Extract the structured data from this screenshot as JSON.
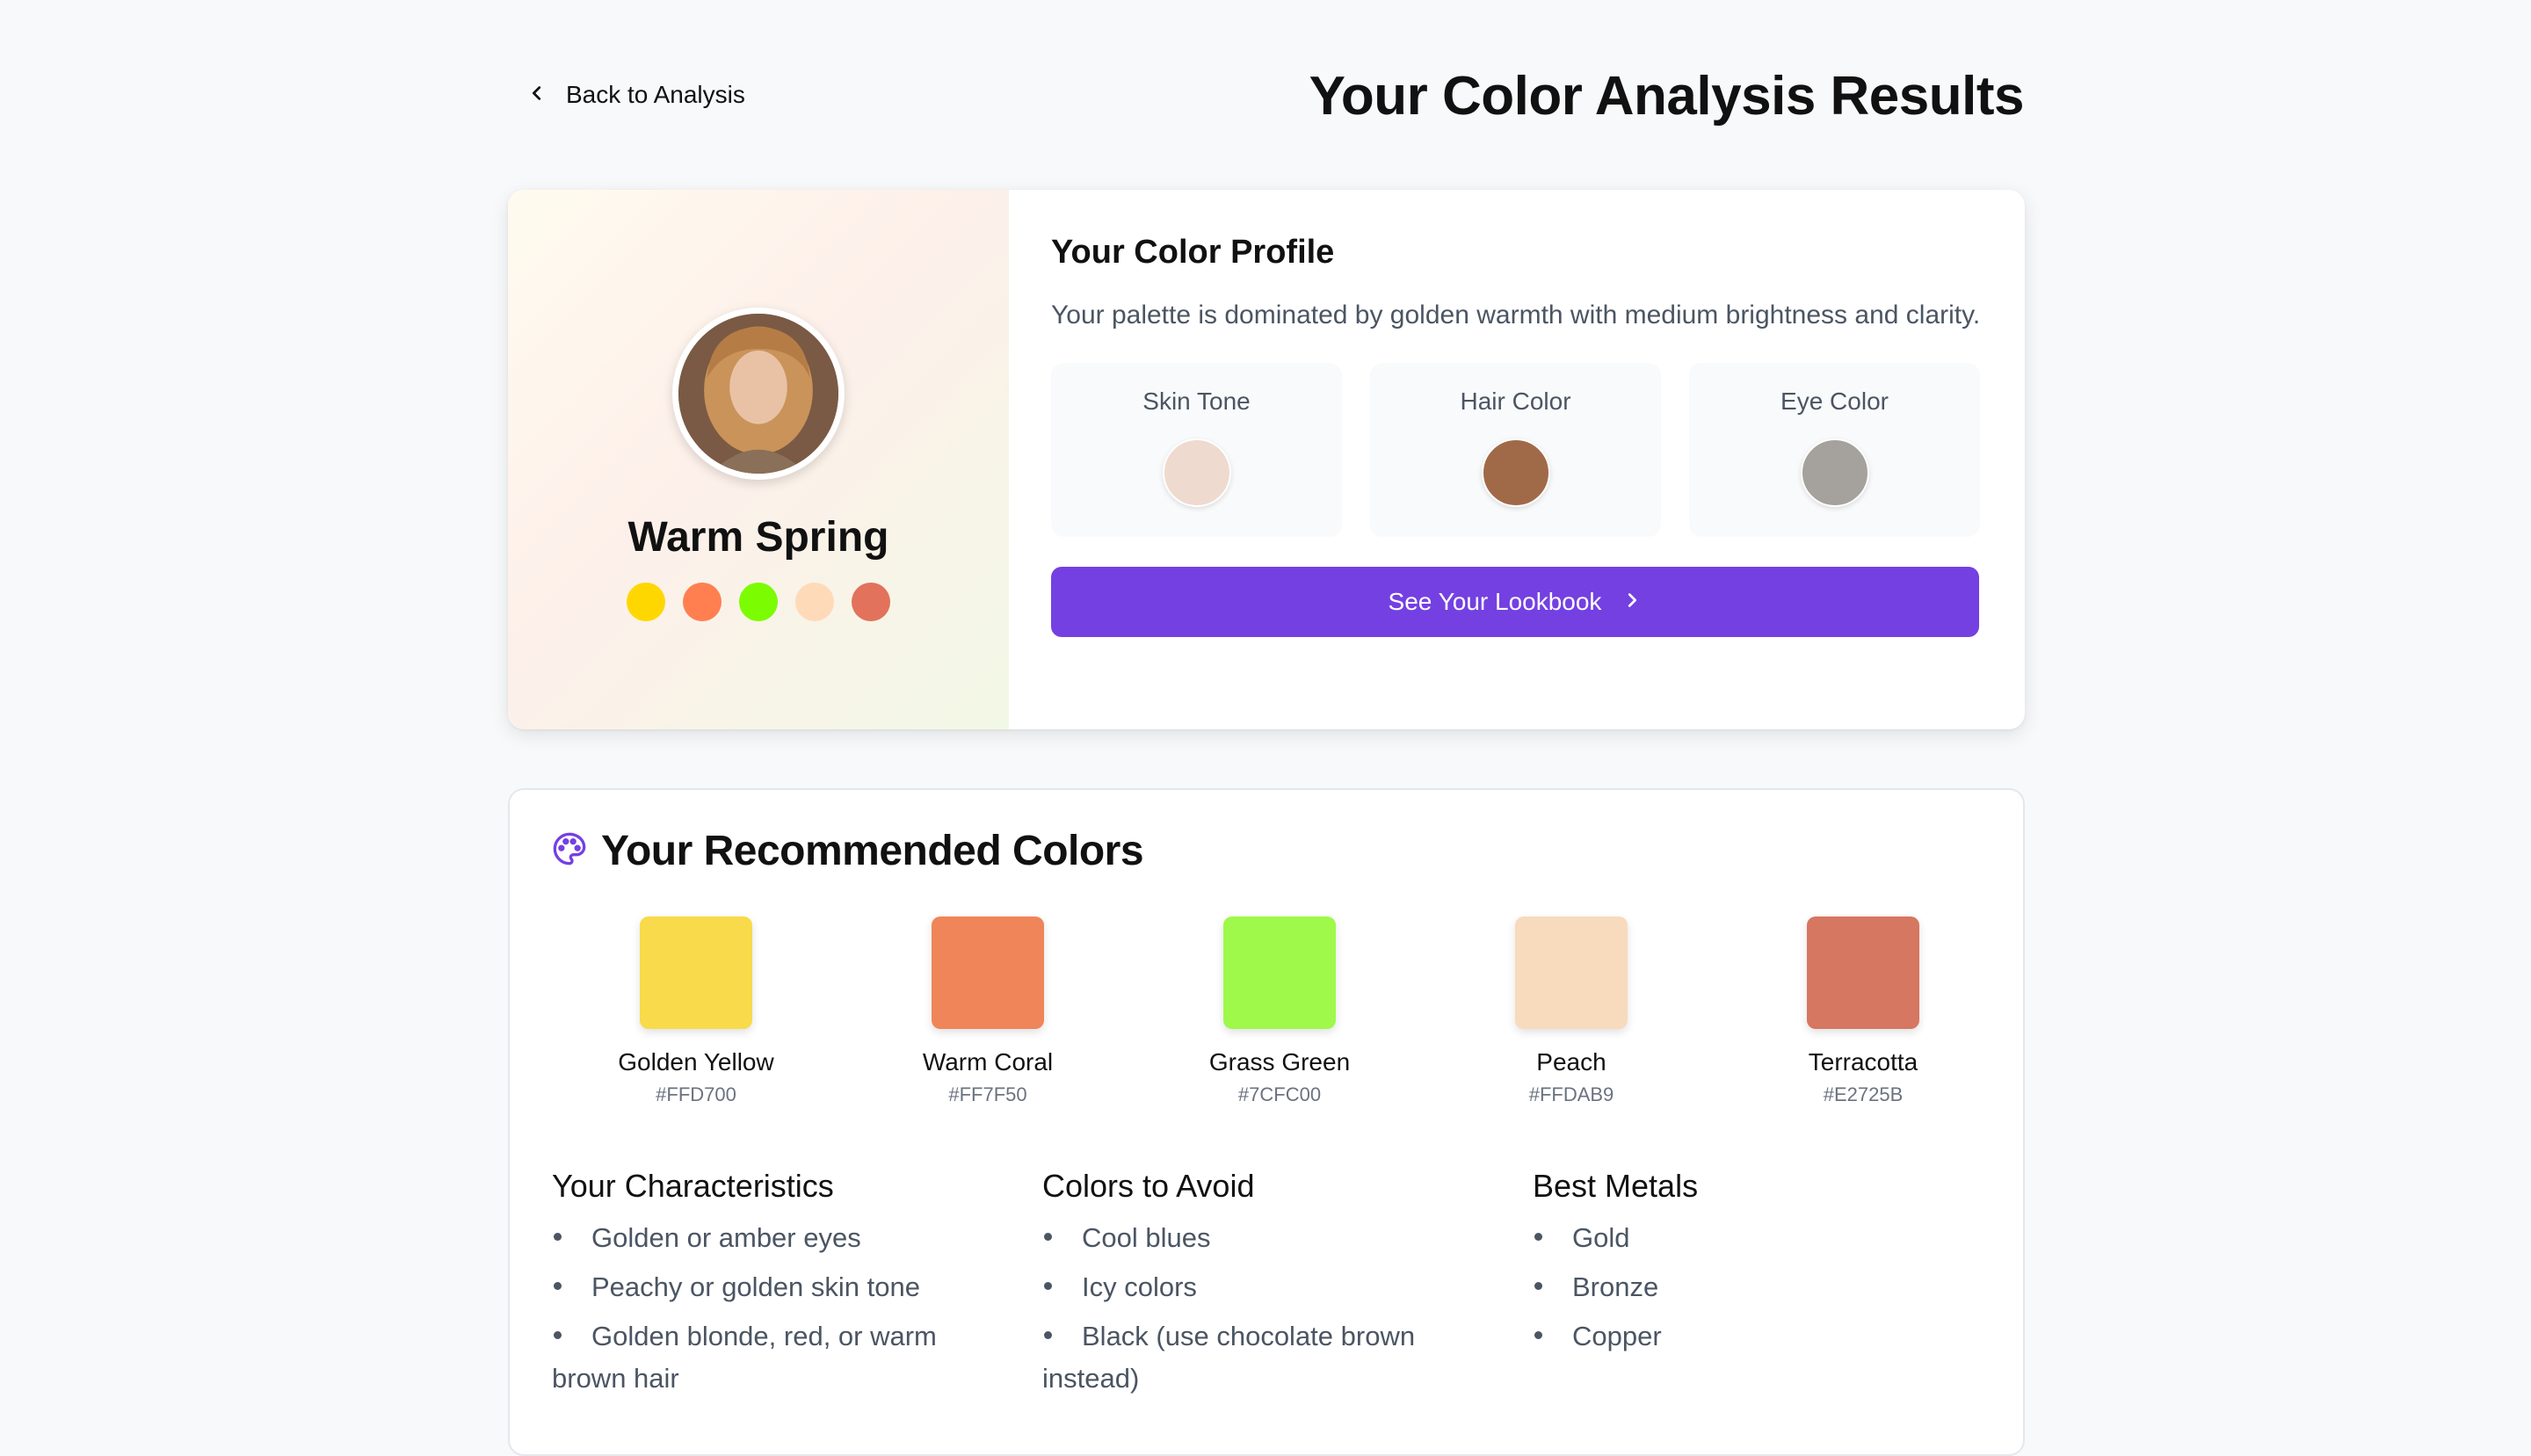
{
  "header": {
    "back_label": "Back to Analysis",
    "title": "Your Color Analysis Results"
  },
  "profile": {
    "season": "Warm Spring",
    "mini_palette": [
      "#FFD700",
      "#FF7F50",
      "#7CFC00",
      "#FFDAB9",
      "#E2725B"
    ],
    "heading": "Your Color Profile",
    "description": "Your palette is dominated by golden warmth with medium brightness and clarity.",
    "features": [
      {
        "label": "Skin Tone",
        "color": "#EFDAD0"
      },
      {
        "label": "Hair Color",
        "color": "#A06A48"
      },
      {
        "label": "Eye Color",
        "color": "#A5A19C"
      }
    ],
    "lookbook_label": "See Your Lookbook"
  },
  "recommended": {
    "title": "Your Recommended Colors",
    "colors": [
      {
        "name": "Golden Yellow",
        "hex": "#FFD700",
        "display": "#F8DA4A"
      },
      {
        "name": "Warm Coral",
        "hex": "#FF7F50",
        "display": "#EF8559"
      },
      {
        "name": "Grass Green",
        "hex": "#7CFC00",
        "display": "#9EF94A"
      },
      {
        "name": "Peach",
        "hex": "#FFDAB9",
        "display": "#F8DABC"
      },
      {
        "name": "Terracotta",
        "hex": "#E2725B",
        "display": "#D67761"
      }
    ]
  },
  "characteristics": {
    "title": "Your Characteristics",
    "items": [
      "Golden or amber eyes",
      "Peachy or golden skin tone",
      "Golden blonde, red, or warm brown hair"
    ]
  },
  "avoid": {
    "title": "Colors to Avoid",
    "items": [
      "Cool blues",
      "Icy colors",
      "Black (use chocolate brown instead)"
    ]
  },
  "metals": {
    "title": "Best Metals",
    "items": [
      "Gold",
      "Bronze",
      "Copper"
    ]
  },
  "colors": {
    "accent": "#7440E2",
    "background": "#F8F9FB"
  }
}
